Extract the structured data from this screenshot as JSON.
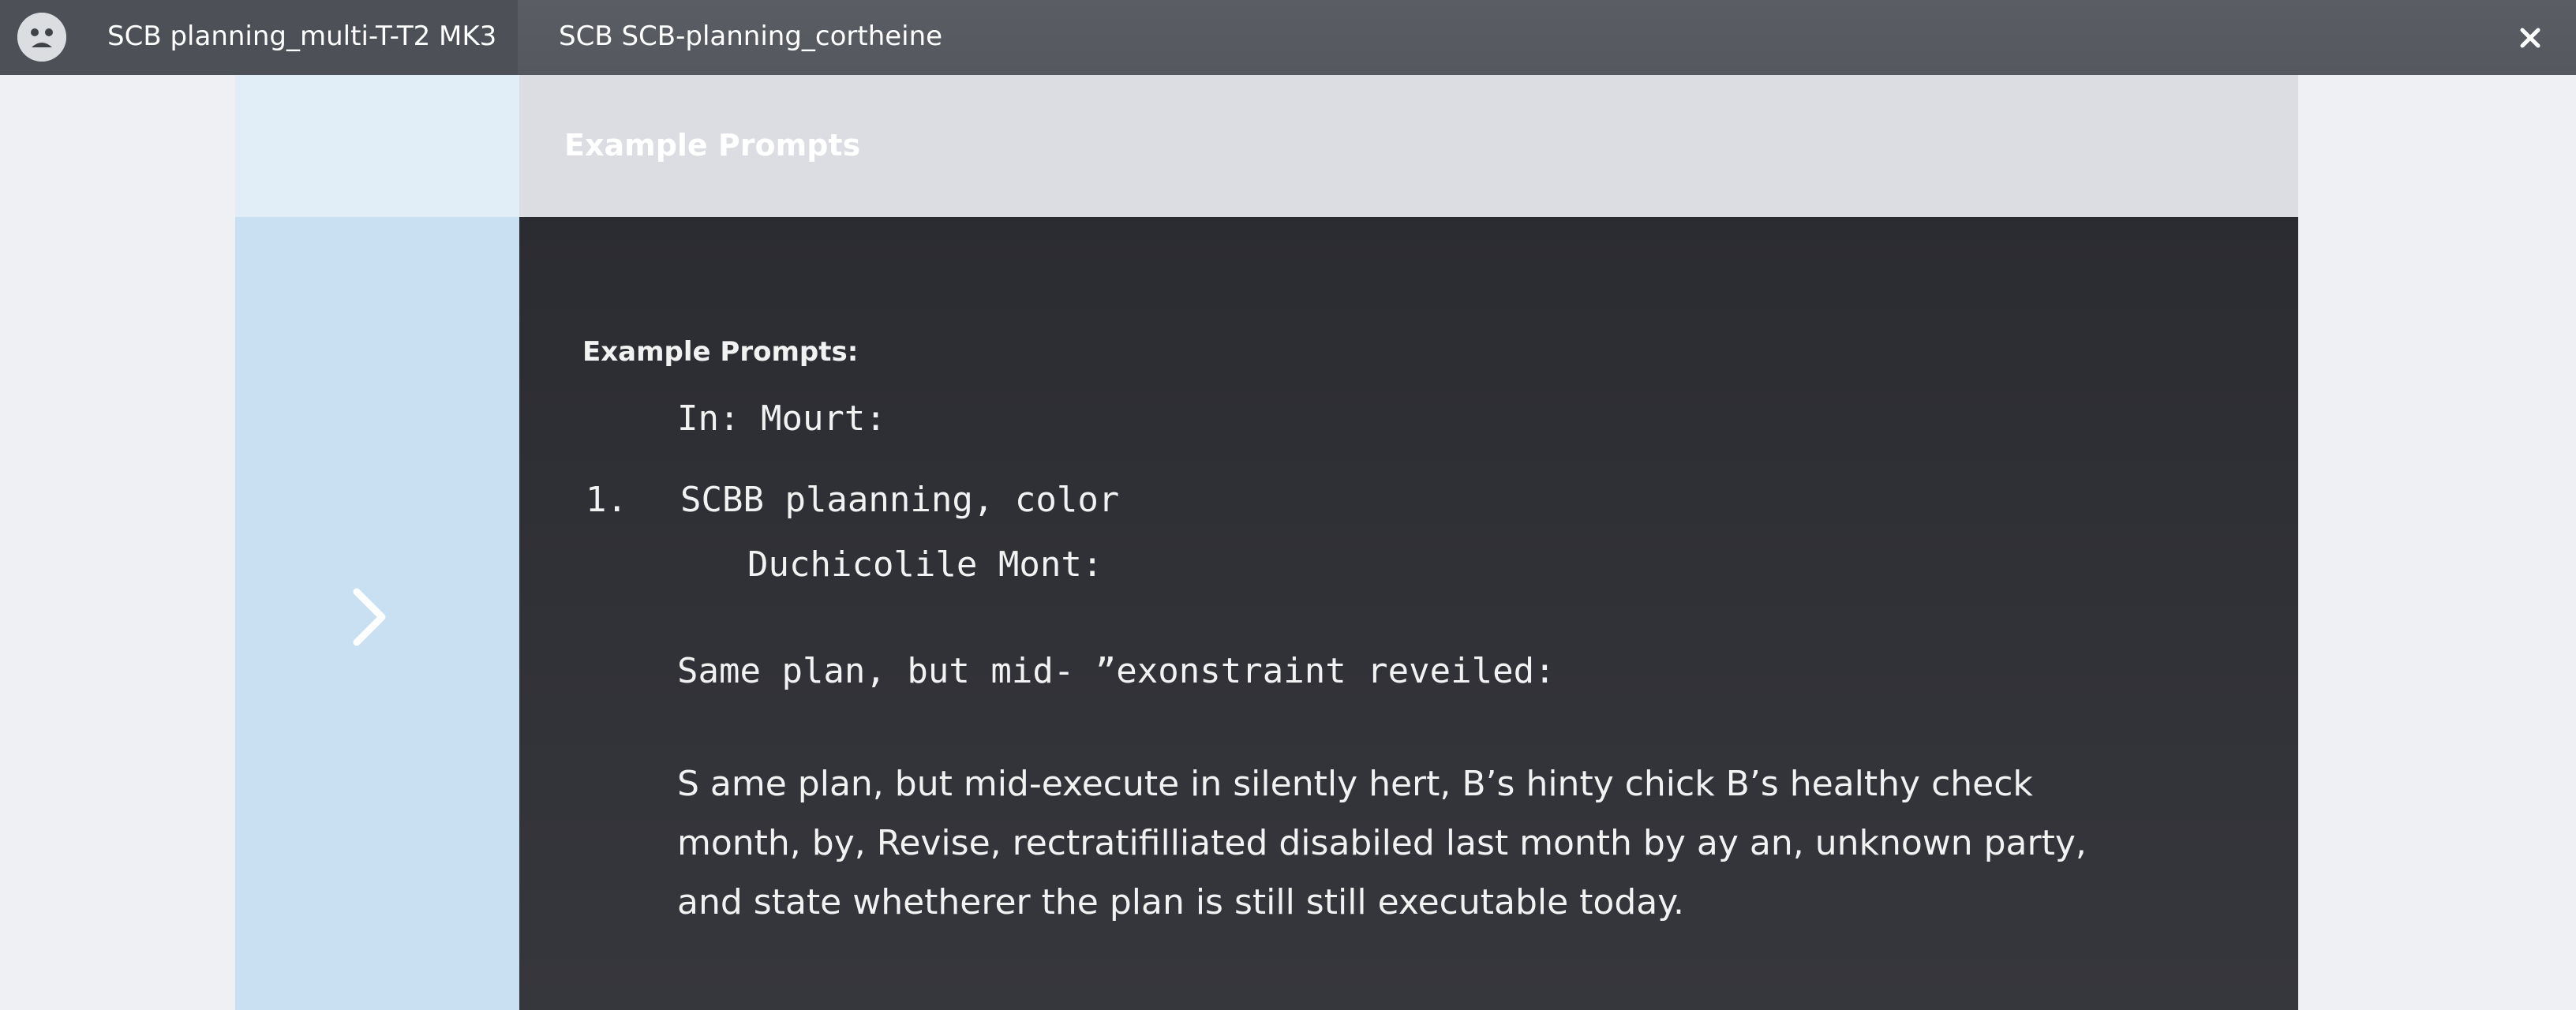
{
  "window": {
    "tabs": [
      {
        "label": "SCB planning_multi-T-T2 MK3",
        "active": true
      },
      {
        "label": "SCB SCB-planning_cortheine",
        "active": false
      }
    ],
    "app_icon": "user-face-icon",
    "close_icon": "close-icon"
  },
  "header": {
    "title": "Example Prompts"
  },
  "side_panel": {
    "nav_icon": "chevron-right-icon"
  },
  "content": {
    "section_heading": "Example Prompts:",
    "in_line": "In: Mourt:",
    "list": [
      {
        "number": "1.",
        "text": "SCBB plaanning, color",
        "sub": "Duchicolile Mont:"
      }
    ],
    "same_plan_line": "Same plan, but mid- ”exonstraint reveiled:",
    "paragraph_lines": [
      "S ame plan, but mid-execute in silently hert, B’s hinty chick B’s healthy check",
      "month, by, Revise, rectratifilliated disabiled last month by ay an, unknown party,",
      "and state whetherer the plan is still still executable today."
    ]
  },
  "colors": {
    "titlebar": "#55585e",
    "header_band": "#dcdde2",
    "side_panel": "#c9e0f3",
    "content_bg": "#2f3035",
    "text": "#f2f2f2"
  }
}
